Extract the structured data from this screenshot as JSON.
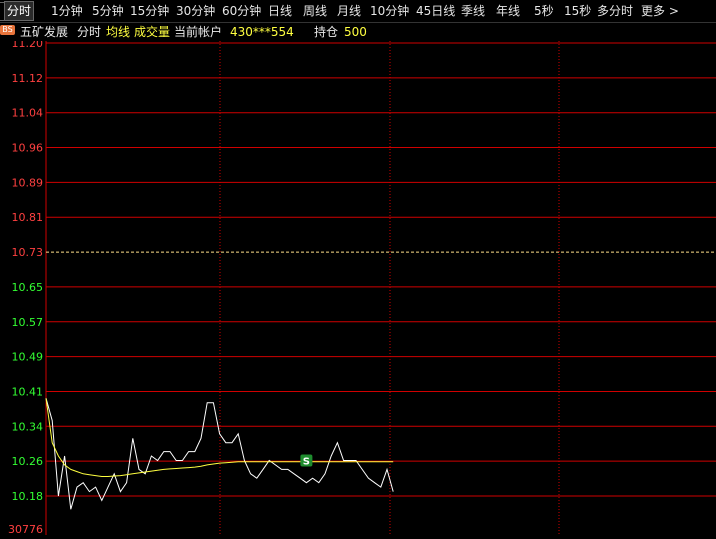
{
  "tabs": [
    {
      "label": "分时",
      "active": true
    },
    {
      "label": "1分钟"
    },
    {
      "label": "5分钟"
    },
    {
      "label": "15分钟"
    },
    {
      "label": "30分钟"
    },
    {
      "label": "60分钟"
    },
    {
      "label": "日线"
    },
    {
      "label": "周线"
    },
    {
      "label": "月线"
    },
    {
      "label": "10分钟"
    },
    {
      "label": "45日线"
    },
    {
      "label": "季线"
    },
    {
      "label": "年线"
    },
    {
      "label": "5秒"
    },
    {
      "label": "15秒"
    },
    {
      "label": "多分时"
    },
    {
      "label": "更多 >"
    }
  ],
  "info": {
    "badge": "BS",
    "stock_name": "五矿发展",
    "chart_mode": "分时",
    "avg_line": "均线",
    "volume": "成交量",
    "account_label": "当前帐户",
    "account_id": "430***554",
    "position_label": "持仓",
    "position_value": "500"
  },
  "colors": {
    "grid": "#d00000",
    "up": "#ff4040",
    "down": "#33ff33",
    "price_line": "#ffffff",
    "avg_line": "#ffff40",
    "prev_close": "#ffe08a",
    "marker_bg": "#1e8c2e"
  },
  "chart_data": {
    "type": "line",
    "ylim": [
      10.18,
      11.2
    ],
    "prev_close": 10.73,
    "y_ticks": [
      "11.20",
      "11.12",
      "11.04",
      "10.96",
      "10.89",
      "10.81",
      "10.73",
      "10.65",
      "10.57",
      "10.49",
      "10.41",
      "10.34",
      "10.26",
      "10.18"
    ],
    "volume_label": "30776",
    "trade_marker": {
      "label": "S",
      "index": 42,
      "value": 10.26
    },
    "series": [
      {
        "kind": "price",
        "values": [
          10.4,
          10.35,
          10.18,
          10.27,
          10.15,
          10.2,
          10.21,
          10.19,
          10.2,
          10.17,
          10.2,
          10.23,
          10.19,
          10.21,
          10.31,
          10.24,
          10.23,
          10.27,
          10.26,
          10.28,
          10.28,
          10.26,
          10.26,
          10.28,
          10.28,
          10.31,
          10.39,
          10.39,
          10.32,
          10.3,
          10.3,
          10.32,
          10.26,
          10.23,
          10.22,
          10.24,
          10.26,
          10.25,
          10.24,
          10.24,
          10.23,
          10.22,
          10.21,
          10.22,
          10.21,
          10.23,
          10.27,
          10.3,
          10.26,
          10.26,
          10.26,
          10.24,
          10.22,
          10.21,
          10.2,
          10.24,
          10.19
        ]
      },
      {
        "kind": "avg",
        "values": [
          10.4,
          10.3,
          10.27,
          10.25,
          10.24,
          10.235,
          10.23,
          10.228,
          10.226,
          10.224,
          10.224,
          10.225,
          10.226,
          10.228,
          10.23,
          10.232,
          10.234,
          10.236,
          10.238,
          10.24,
          10.241,
          10.242,
          10.243,
          10.244,
          10.245,
          10.247,
          10.25,
          10.252,
          10.254,
          10.255,
          10.256,
          10.257,
          10.257,
          10.257,
          10.257,
          10.257,
          10.257,
          10.257,
          10.257,
          10.257,
          10.257,
          10.257,
          10.257,
          10.257,
          10.257,
          10.257,
          10.257,
          10.257,
          10.257,
          10.257,
          10.257,
          10.257,
          10.257,
          10.257,
          10.257,
          10.257,
          10.257
        ]
      }
    ]
  }
}
